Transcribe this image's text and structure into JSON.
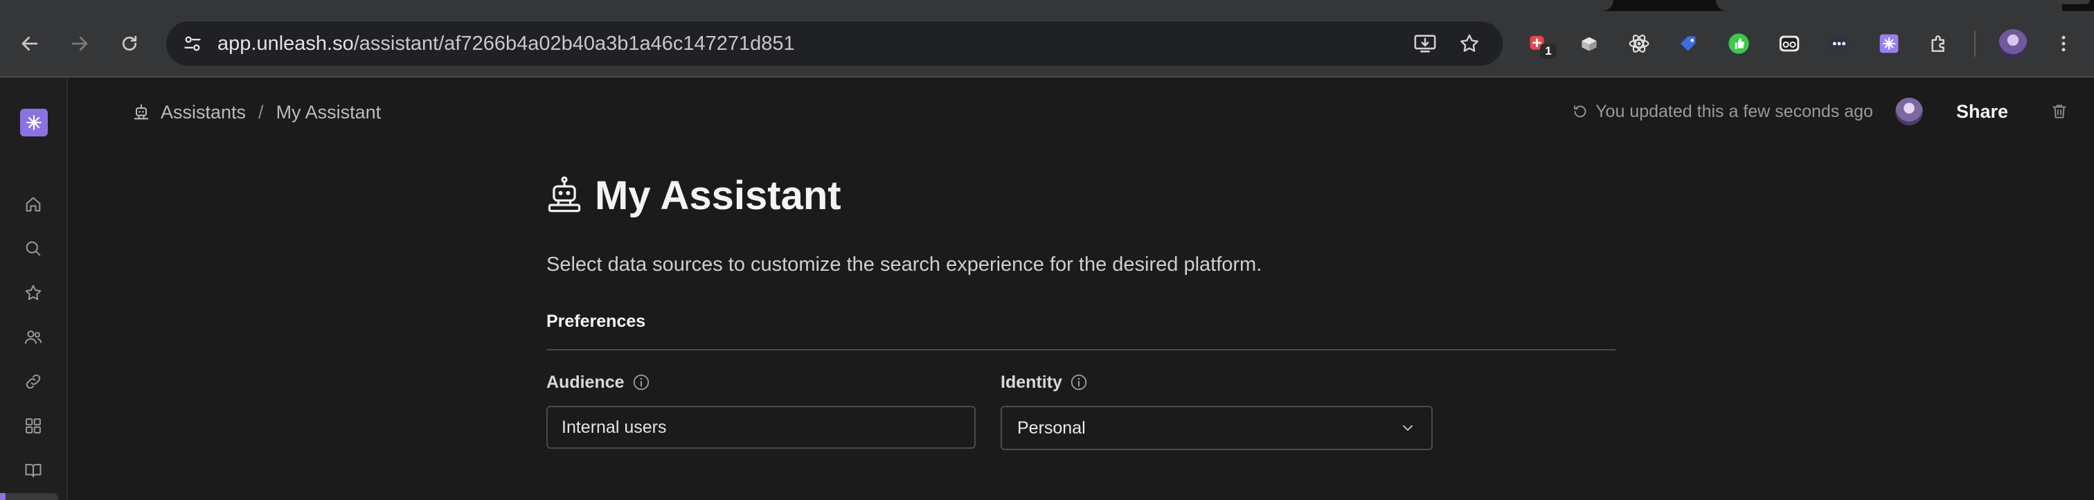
{
  "browser": {
    "url_host": "app.unleash.so",
    "url_path": "/assistant/af7266b4a02b40a3b1a46c147271d851",
    "extensions": [
      {
        "name": "red-plus-extension-icon",
        "badge": "1"
      },
      {
        "name": "box-extension-icon"
      },
      {
        "name": "react-atom-icon"
      },
      {
        "name": "blue-tag-icon"
      },
      {
        "name": "green-thumb-icon"
      },
      {
        "name": "glasses-icon"
      },
      {
        "name": "dots-extension-icon"
      },
      {
        "name": "unleash-extension-icon"
      },
      {
        "name": "puzzle-icon"
      }
    ]
  },
  "breadcrumb": {
    "parent": "Assistants",
    "separator": "/",
    "current": "My Assistant"
  },
  "header": {
    "updated_text": "You updated this a few seconds ago",
    "share_label": "Share"
  },
  "page": {
    "title": "My Assistant",
    "description": "Select data sources to customize the search experience for the desired platform.",
    "section_title": "Preferences"
  },
  "fields": {
    "audience": {
      "label": "Audience",
      "value": "Internal users"
    },
    "identity": {
      "label": "Identity",
      "value": "Personal"
    }
  },
  "colors": {
    "accent": "#8a73e0",
    "background": "#1b1b1b"
  }
}
